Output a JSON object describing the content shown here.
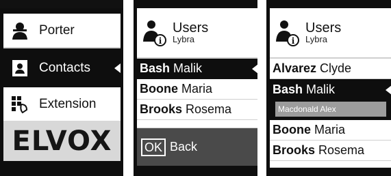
{
  "menu_screen": {
    "items": [
      {
        "label": "Porter",
        "icon": "porter-icon",
        "selected": false
      },
      {
        "label": "Contacts",
        "icon": "contacts-icon",
        "selected": true
      },
      {
        "label": "Extension",
        "icon": "extension-icon",
        "selected": false
      }
    ],
    "logo": "ELVOX"
  },
  "users_screen": {
    "header": {
      "title": "Users",
      "subtitle": "Lybra",
      "icon": "users-icon"
    },
    "list": [
      {
        "last": "Bash",
        "first": "Malik",
        "selected": true
      },
      {
        "last": "Boone",
        "first": "Maria",
        "selected": false
      },
      {
        "last": "Brooks",
        "first": "Rosema",
        "selected": false
      }
    ],
    "footer": {
      "ok_label": "OK",
      "back_label": "Back"
    }
  },
  "users_search_screen": {
    "header": {
      "title": "Users",
      "subtitle": "Lybra",
      "icon": "users-icon"
    },
    "list": [
      {
        "last": "Alvarez",
        "first": "Clyde",
        "selected": false
      },
      {
        "last": "Bash",
        "first": "Malik",
        "selected": true
      },
      {
        "hint": "Macdonald Alex"
      },
      {
        "last": "Boone",
        "first": "Maria",
        "selected": false
      },
      {
        "last": "Brooks",
        "first": "Rosema",
        "selected": false
      }
    ]
  },
  "colors": {
    "screen_bg": "#0e0e0e",
    "selected_bg": "#0e0e0e",
    "row_bg": "#ffffff",
    "hint_bg": "#9c9c9c",
    "footer_bg": "#4a4a4a",
    "logo_bg": "#d8d8d8"
  }
}
